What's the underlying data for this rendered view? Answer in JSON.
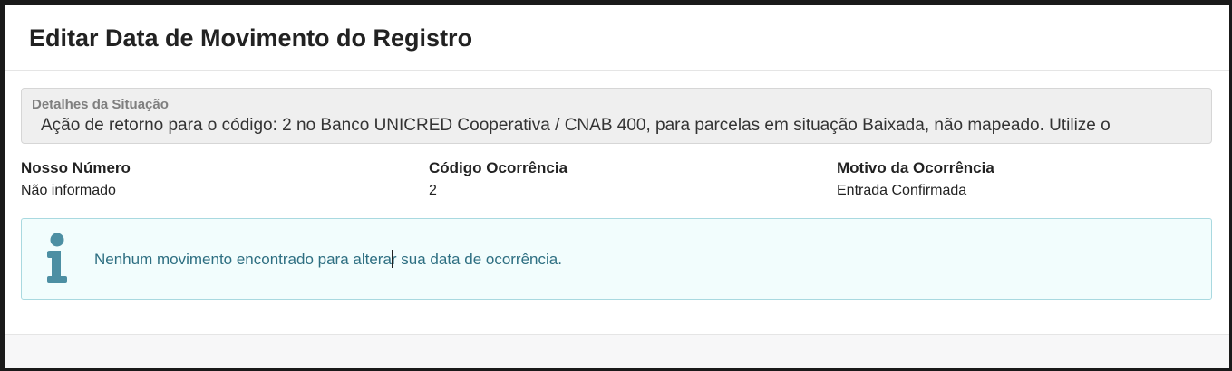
{
  "modal": {
    "title": "Editar Data de Movimento do Registro"
  },
  "details": {
    "legend": "Detalhes da Situação",
    "text": "Ação de retorno para o código: 2 no Banco UNICRED Cooperativa / CNAB 400, para parcelas em situação Baixada, não mapeado. Utilize o"
  },
  "fields": [
    {
      "label": "Nosso Número",
      "value": "Não informado"
    },
    {
      "label": "Código Ocorrência",
      "value": "2"
    },
    {
      "label": "Motivo da Ocorrência",
      "value": "Entrada Confirmada"
    }
  ],
  "alert": {
    "icon": "info-icon",
    "text_before_cursor": "Nenhum movimento encontrado para altera",
    "text_after_cursor": "r sua data de ocorrência.",
    "color": "#2e6f82"
  }
}
